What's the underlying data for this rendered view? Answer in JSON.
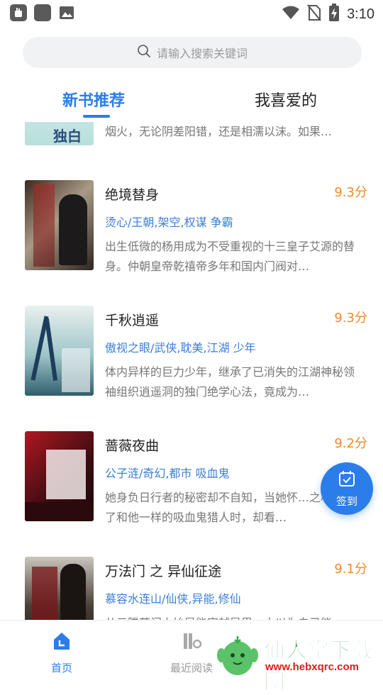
{
  "status_bar": {
    "time": "3:10"
  },
  "search": {
    "placeholder": "请输入搜索关键词"
  },
  "tabs": [
    {
      "label": "新书推荐",
      "active": true
    },
    {
      "label": "我喜爱的",
      "active": false
    }
  ],
  "partial_book": {
    "cover_text": "独白",
    "desc": "烟火，无论阴差阳错，还是相濡以沫。如果…"
  },
  "books": [
    {
      "title": "绝境替身",
      "score": "9.3分",
      "tags": "烫心/王朝,架空,权谋 争霸",
      "desc": "出生低微的杨用成为不受重视的十三皇子艾源的替身。仲朝皇帝乾禧帝多年和国内门阀对…"
    },
    {
      "title": "千秋逍遥",
      "score": "9.3分",
      "tags": "傲视之眼/武侠,耽美,江湖 少年",
      "desc": "体内异样的巨力少年，继承了已消失的江湖神秘领袖组织逍遥洞的独门绝学心法，竟成为…"
    },
    {
      "title": "蔷薇夜曲",
      "score": "9.2分",
      "tags": "公子涟/奇幻,都市 吸血鬼",
      "desc": "她身负日行者的秘密却不自知，当她怀…之心成为了和他一样的吸血鬼猎人时，却看…"
    },
    {
      "title": "万法门 之 异仙征途",
      "score": "9.1分",
      "tags": "慕容水连山/仙侠,异能,修仙",
      "desc": "从元腾苍门上始异能宣越异果，本以为自己能…"
    }
  ],
  "sign_button": {
    "label": "签到"
  },
  "bottom_nav": [
    {
      "label": "首页",
      "active": true
    },
    {
      "label": "最近阅读",
      "active": false
    }
  ],
  "watermark": {
    "title": "仙人掌下载网",
    "url": "www.hebxqrc.com"
  },
  "colors": {
    "accent": "#2b7de9",
    "score": "#f08a24",
    "tags": "#3b7fd8"
  }
}
